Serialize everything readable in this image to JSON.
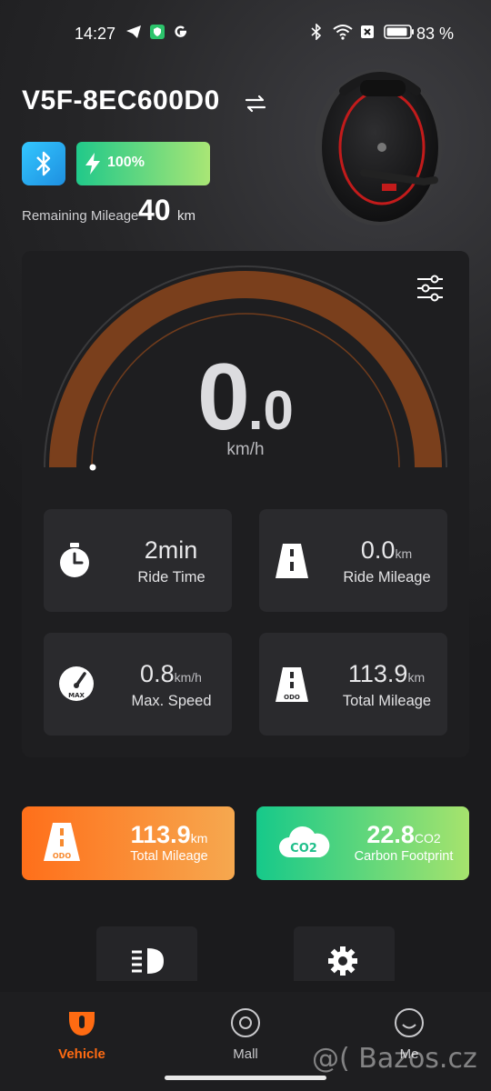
{
  "status_bar": {
    "time": "14:27",
    "battery_percent": "83 %",
    "icons": [
      "telegram-icon",
      "vpn-shield-icon",
      "google-icon",
      "bluetooth-icon",
      "wifi-icon",
      "sim-off-icon",
      "battery-icon"
    ]
  },
  "vehicle": {
    "name": "V5F-8EC600D0",
    "battery_level": "100%",
    "battery_fraction": 1.0,
    "remaining_mileage_label": "Remaining Mileage",
    "remaining_mileage_value": "40",
    "remaining_mileage_unit": "km"
  },
  "speedometer": {
    "speed_integer": "0",
    "speed_decimal": ".0",
    "unit": "km/h",
    "speed_fraction": 0.0
  },
  "stats": [
    {
      "value": "2min",
      "unit": "",
      "label": "Ride Time",
      "icon": "stopwatch-icon"
    },
    {
      "value": "0.0",
      "unit": "km",
      "label": "Ride Mileage",
      "icon": "road-icon"
    },
    {
      "value": "0.8",
      "unit": "km/h",
      "label": "Max. Speed",
      "icon": "max-speed-gauge-icon"
    },
    {
      "value": "113.9",
      "unit": "km",
      "label": "Total Mileage",
      "icon": "odo-road-icon"
    }
  ],
  "summary": {
    "total_mileage": {
      "value": "113.9",
      "unit": "km",
      "label": "Total Mileage"
    },
    "carbon_footprint": {
      "value": "22.8",
      "unit": "CO2",
      "label": "Carbon Footprint"
    }
  },
  "quick_actions": [
    "headlight-icon",
    "gear-icon"
  ],
  "bottom_nav": [
    {
      "label": "Vehicle",
      "active": true
    },
    {
      "label": "Mall",
      "active": false
    },
    {
      "label": "Me",
      "active": false
    }
  ],
  "watermark": "@( Bazos.cz",
  "colors": {
    "accent": "#ff6b12",
    "gauge_fill": "#7a3f1c",
    "battery_start": "#21c98a",
    "battery_end": "#a9e675"
  }
}
